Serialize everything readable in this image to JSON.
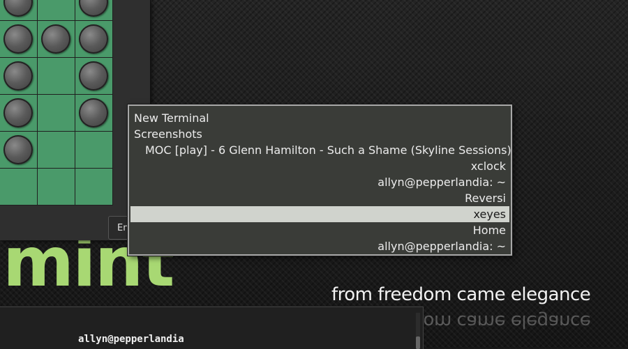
{
  "switcher": {
    "items": [
      {
        "label": "New Terminal",
        "align": "left",
        "selected": false
      },
      {
        "label": "Screenshots",
        "align": "left",
        "selected": false
      },
      {
        "label": "MOC [play] - 6 Glenn Hamilton - Such a Shame (Skyline Sessions)",
        "align": "indent",
        "selected": false
      },
      {
        "label": "xclock",
        "align": "right",
        "selected": false
      },
      {
        "label": "allyn@pepperlandia: ~",
        "align": "right",
        "selected": false
      },
      {
        "label": "Reversi",
        "align": "right",
        "selected": false
      },
      {
        "label": "xeyes",
        "align": "right",
        "selected": true
      },
      {
        "label": "Home",
        "align": "right",
        "selected": false
      },
      {
        "label": "allyn@pepperlandia: ~",
        "align": "right",
        "selected": false
      }
    ]
  },
  "reversi": {
    "button_label": "En",
    "board": [
      [
        1,
        0,
        1
      ],
      [
        1,
        1,
        1
      ],
      [
        1,
        0,
        1
      ],
      [
        1,
        0,
        1
      ],
      [
        1,
        0,
        0
      ],
      [
        0,
        0,
        0
      ]
    ]
  },
  "wallpaper": {
    "logo_text": "mint",
    "slogan": "from freedom came elegance"
  },
  "terminal": {
    "prompt_text": "allyn@pepperlandia"
  },
  "colors": {
    "board_green": "#4a9a6a",
    "logo_green": "#a8d873",
    "selection_bg": "#d0d3cd",
    "popup_bg": "#3a3c38"
  }
}
